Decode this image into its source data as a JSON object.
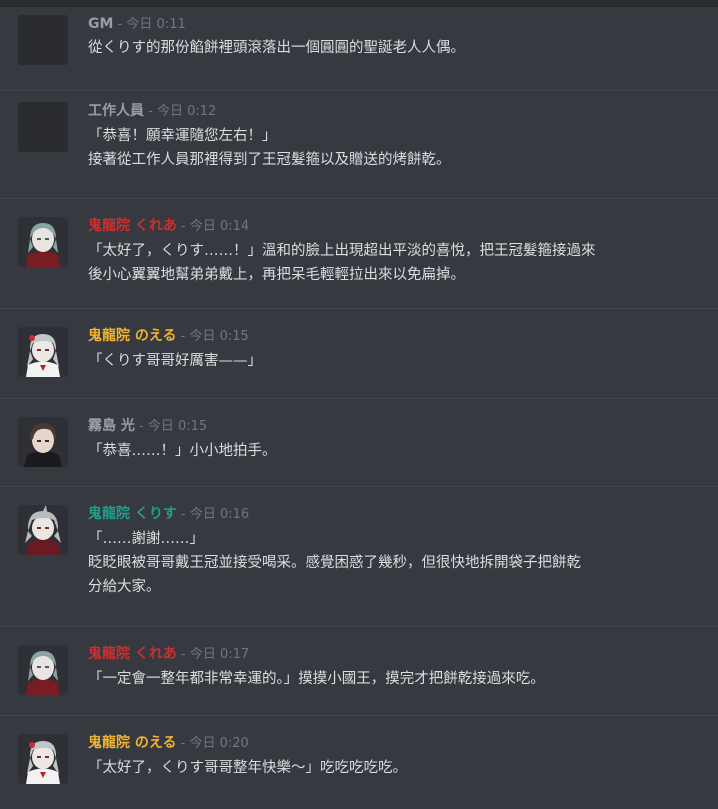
{
  "colors": {
    "background": "#36393f",
    "gm": "#9a9da3",
    "kurea": "#cc2f2f",
    "noeru": "#f0b232",
    "kurisu": "#1f9e8a",
    "hikaru": "#9a9da3",
    "time": "#72767d",
    "text": "#dcddde"
  },
  "messages": [
    {
      "author": "GM",
      "author_color": "gm",
      "separator": " - ",
      "time": "今日 0:11",
      "avatar": "blank-avatar",
      "lines": [
        "從くりす的那份餡餅裡頭滾落出一個圓圓的聖誕老人人偶。"
      ]
    },
    {
      "author": "工作人員",
      "author_color": "gm",
      "separator": " - ",
      "time": "今日 0:12",
      "avatar": "blank-avatar",
      "lines": [
        "「恭喜！願幸運隨您左右！」",
        "接著從工作人員那裡得到了王冠髮箍以及贈送的烤餅乾。"
      ]
    },
    {
      "author": "鬼龍院 くれあ",
      "author_color": "kurea",
      "separator": " - ",
      "time": "今日 0:14",
      "avatar": "kurea-avatar",
      "lines": [
        "「太好了，くりす……！」溫和的臉上出現超出平淡的喜悅，把王冠髮箍接過來",
        "後小心翼翼地幫弟弟戴上，再把呆毛輕輕拉出來以免扁掉。"
      ]
    },
    {
      "author": "鬼龍院 のえる",
      "author_color": "noeru",
      "separator": " - ",
      "time": "今日 0:15",
      "avatar": "noeru-avatar",
      "lines": [
        "「くりす哥哥好厲害——」"
      ]
    },
    {
      "author": "霧島 光",
      "author_color": "hikaru",
      "separator": " - ",
      "time": "今日 0:15",
      "avatar": "hikaru-avatar",
      "lines": [
        "「恭喜……！」小小地拍手。"
      ]
    },
    {
      "author": "鬼龍院 くりす",
      "author_color": "kurisu",
      "separator": " - ",
      "time": "今日 0:16",
      "avatar": "kurisu-avatar",
      "lines": [
        "「……謝謝……」",
        "眨眨眼被哥哥戴王冠並接受喝采。感覺困惑了幾秒，但很快地拆開袋子把餅乾",
        "分給大家。"
      ]
    },
    {
      "author": "鬼龍院 くれあ",
      "author_color": "kurea",
      "separator": " - ",
      "time": "今日 0:17",
      "avatar": "kurea-avatar",
      "lines": [
        "「一定會一整年都非常幸運的。」摸摸小國王，摸完才把餅乾接過來吃。"
      ]
    },
    {
      "author": "鬼龍院 のえる",
      "author_color": "noeru",
      "separator": " - ",
      "time": "今日 0:20",
      "avatar": "noeru-avatar",
      "lines": [
        "「太好了，くりす哥哥整年快樂～」吃吃吃吃吃。"
      ]
    }
  ]
}
